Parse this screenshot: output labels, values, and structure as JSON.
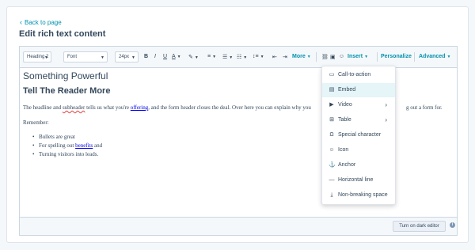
{
  "back_link": "Back to page",
  "page_title": "Edit rich text content",
  "toolbar": {
    "heading": "Heading 2",
    "font": "Font",
    "size": "24px",
    "bold": "B",
    "italic": "I",
    "underline": "U",
    "text_color": "A",
    "more": "More",
    "insert": "Insert",
    "personalize": "Personalize",
    "advanced": "Advanced"
  },
  "content": {
    "h1": "Something Powerful",
    "h2": "Tell The Reader More",
    "para_a": "The headline and ",
    "para_subheader": "subheader",
    "para_b": " tells us what you're ",
    "para_offering": "offering",
    "para_c": ", and the form header closes the deal. Over here you can explain why you",
    "para_tail": "g out a form for.",
    "remember": "Remember:",
    "bullet1": "Bullets are great",
    "bullet2_a": "For spelling out ",
    "bullet2_link": "benefits",
    "bullet2_b": " and",
    "bullet3": "Turning visitors into leads."
  },
  "insert_menu": {
    "items": [
      {
        "label": "Call-to-action",
        "icon": "cta-icon"
      },
      {
        "label": "Embed",
        "icon": "embed-icon"
      },
      {
        "label": "Video",
        "icon": "video-icon"
      },
      {
        "label": "Table",
        "icon": "table-icon"
      },
      {
        "label": "Special character",
        "icon": "omega-icon"
      },
      {
        "label": "Icon",
        "icon": "icon-icon"
      },
      {
        "label": "Anchor",
        "icon": "anchor-icon"
      },
      {
        "label": "Horizontal line",
        "icon": "horizontal-line-icon"
      },
      {
        "label": "Non-breaking space",
        "icon": "nbsp-icon"
      }
    ]
  },
  "footer": {
    "dark_editor_button": "Turn on dark editor",
    "info": "i"
  },
  "colors": {
    "accent": "#0091ae",
    "text": "#33475b",
    "border": "#cbd6e2",
    "active_item": "#e5f5f8"
  }
}
